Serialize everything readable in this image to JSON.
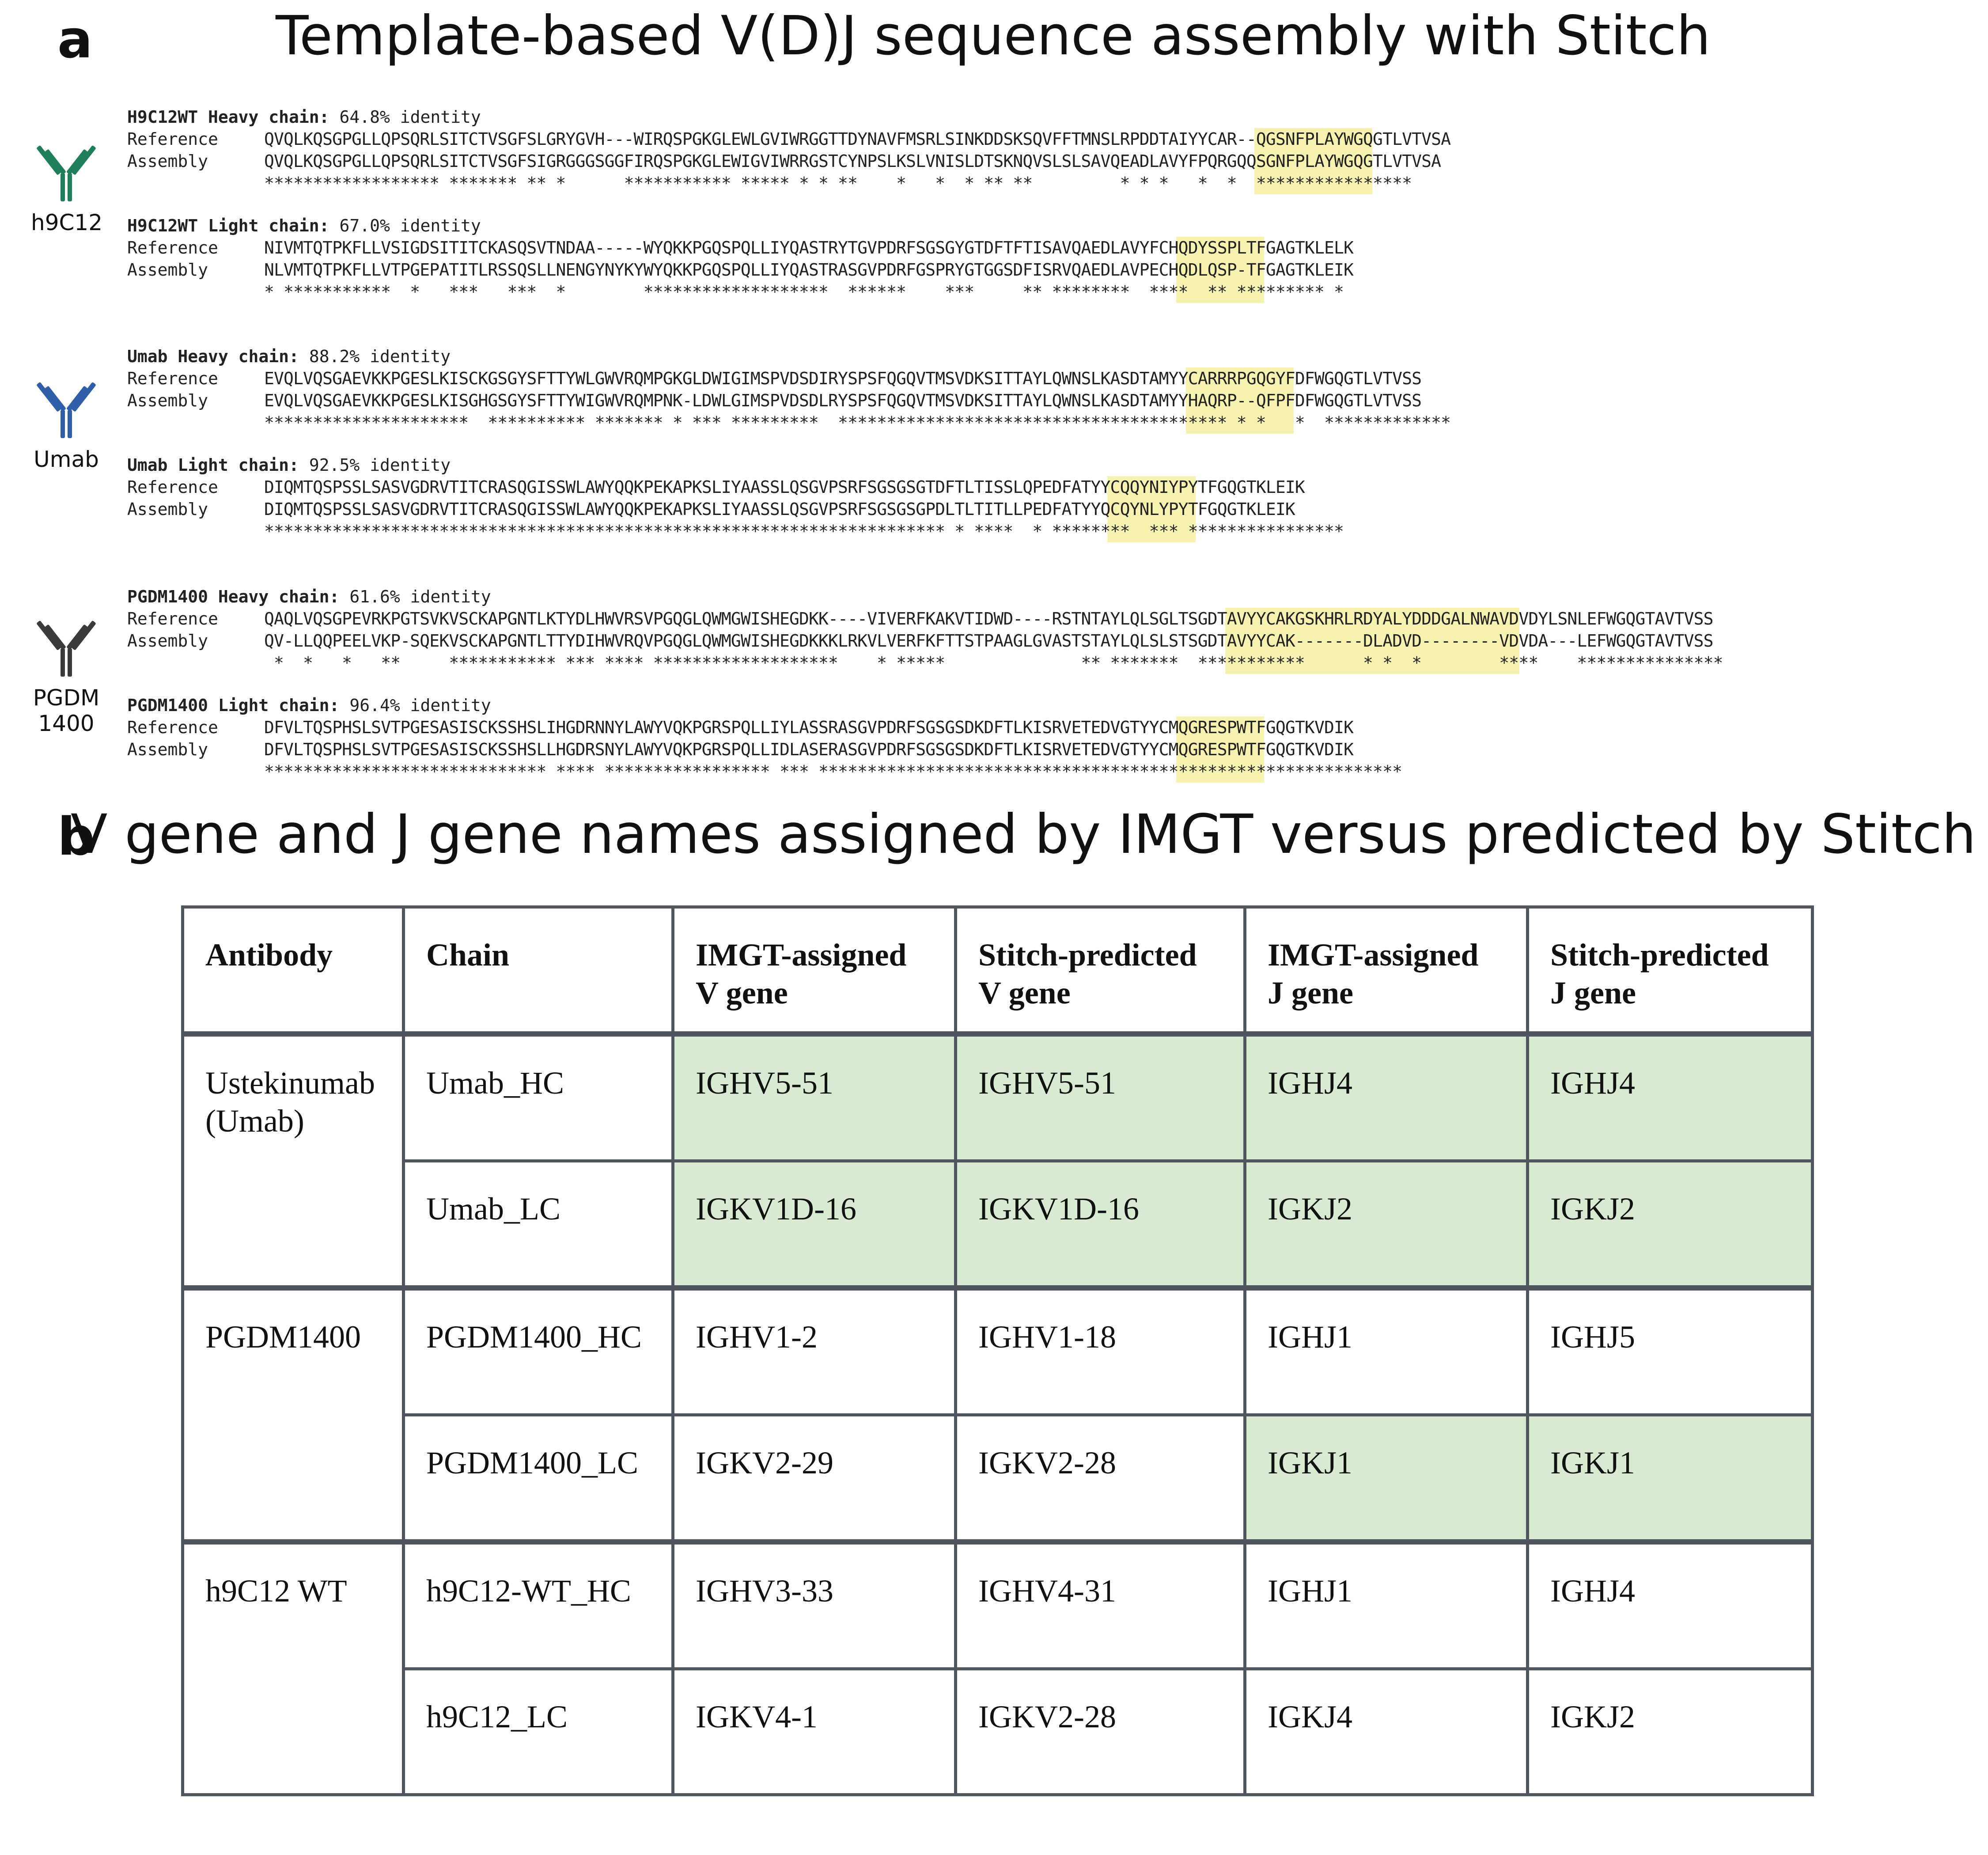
{
  "panel_a": {
    "letter": "a",
    "title": "Template-based V(D)J sequence assembly with Stitch",
    "groups": [
      {
        "icon_label": "h9C12",
        "icon_color": "#1e7f5a",
        "chains": [
          {
            "name": "H9C12WT Heavy chain:",
            "identity": " 64.8% identity",
            "reference_label": "Reference",
            "reference": "QVQLKQSGPGLLQPSQRLSITCTVSGFSLGRYGVH---WIRQSPGKGLEWLGVIWRGGTTDYNAVFMSRLSINKDDSKSQVFFTMNSLRPDDTAIYYCAR--QGSNFPLAYWGQGTLVTVSA",
            "assembly_label": "Assembly",
            "assembly": "QVQLKQSGPGLLQPSQRLSITCTVSGFSIGRGGGSGGFIRQSPGKGLEWIGVIWRRGSTCYNPSLKSLVNISLDTSKNQVSLSLSAVQEADLAVYFPQRGQQSGNFPLAYWGQGTLVTVSA",
            "conservation": "****************** ******* ** *      *********** ***** * * **    *   *  * ** **         * * *   *  *  ****************"
          },
          {
            "name": "H9C12WT Light chain:",
            "identity": " 67.0% identity",
            "reference_label": "Reference",
            "reference": "NIVMTQTPKFLLVSIGDSITITCKASQSVTNDAA-----WYQKKPGQSPQLLIYQASTRYTGVPDRFSGSGYGTDFTFTISAVQAEDLAVYFCHQDYSSPLTFGAGTKLELK",
            "assembly_label": "Assembly",
            "assembly": "NLVMTQTPKFLLVTPGEPATITLRSSQSLLNENGYNYKYWYQKKPGQSPQLLIYQASTRASGVPDRFGSPRYGTGGSDFISRVQAEDLAVPECHQDLQSP-TFGAGTKLEIK",
            "conservation": "* ***********  *   ***   ***  *        *******************  ******    ***     ** ********  ****  ** ********* *"
          },
          {
            "name": "Umab Heavy chain:",
            "identity": " 88.2% identity",
            "reference_label": "Reference",
            "reference": "EVQLVQSGAEVKKPGESLKISCKGSGYSFTTYWLGWVRQMPGKGLDWIGIMSPVDSDIRYSPSFQGQVTMSVDKSITTAYLQWNSLKASDTAMYYCARRRPGQGYFDFWGQGTLVTVSS",
            "assembly_label": "Assembly",
            "assembly": "EVQLVQSGAEVKKPGESLKISGHGSGYSFTTYWIGWVRQMPNK-LDWLGIMSPVDSDLRYSPSFQGQVTMSVDKSITTAYLQWNSLKASDTAMYYHAQRP--QFPFDFWGQGTLVTVSS",
            "conservation": "*********************  ********** ******* * *** *********  **************************************** * *   *  *************"
          },
          {
            "name": "Umab Light chain:",
            "identity": " 92.5% identity",
            "reference_label": "Reference",
            "reference": "DIQMTQSPSSLSASVGDRVTITCRASQGISSWLAWYQQKPEKAPKSLIYAASSLQSGVPSRFSGSGSGTDFTLTISSLQPEDFATYYCQQYNIYPYTFGQGTKLEIK",
            "assembly_label": "Assembly",
            "assembly": "DIQMTQSPSSLSASVGDRVTITCRASQGISSWLAWYQQKPEKAPKSLIYAASSLQSGVPSRFSGSGSGPDLTLTITLLPEDFATYYQCQYNLYPYTFGQGTKLEIK",
            "conservation": "********************************************************************** * ****  * ********  *** ****************"
          },
          {
            "name": "PGDM1400 Heavy chain:",
            "identity": " 61.6% identity",
            "reference_label": "Reference",
            "reference": "QAQLVQSGPEVRKPGTSVKVSCKAPGNTLKTYDLHWVRSVPGQGLQWMGWISHEGDKK----VIVERFKAKVTIDWD----RSTNTAYLQLSGLTSGDTAVYYCAKGSKHRLRDYALYDDDGALNWAVDVDYLSNLEFWGQGTAVTVSS",
            "assembly_label": "Assembly",
            "assembly": "QV-LLQQPEELVKP-SQEKVSCKAPGNTLTTYDIHWVRQVPGQGLQWMGWISHEGDKKKLRKVLVERFKFTTSTPAAGLGVASTSTAYLQLSLSTSGDTAVYYCAK-------DLADVD--------VDVDA---LEFWGQGTAVTVSS",
            "conservation": " *  *   *   **     *********** *** **** *******************    * *****              ** *******  ***********      * *  *        ****    ***************"
          },
          {
            "name": "PGDM1400 Light chain:",
            "identity": " 96.4% identity",
            "reference_label": "Reference",
            "reference": "DFVLTQSPHSLSVTPGESASISCKSSHSLIHGDRNNYLAWYVQKPGRSPQLLIYLASSRASGVPDRFSGSGSDKDFTLKISRVETEDVGTYYCMQGRESPWTFGQGTKVDIK",
            "assembly_label": "Assembly",
            "assembly": "DFVLTQSPHSLSVTPGESASISCKSSHSLLHGDRSNYLAWYVQKPGRSPQLLIDLASERASGVPDRFSGSGSDKDFTLKISRVETEDVGTYYCMQGRESPWTFGQGTKVDIK",
            "conservation": "***************************** **** ***************** *** ************************************************************"
          }
        ]
      },
      {
        "icon_label": "Umab",
        "icon_color": "#2f5fa8"
      },
      {
        "icon_label": "PGDM\n1400",
        "icon_color": "#3a3a3a"
      }
    ],
    "highlight_color": "#f7f2b0"
  },
  "panel_b": {
    "letter": "b",
    "title": "V gene and J gene names assigned by IMGT versus predicted by Stitch",
    "headers": [
      "Antibody",
      "Chain",
      "IMGT-assigned\nV gene",
      "Stitch-predicted\nV gene",
      "IMGT-assigned\nJ gene",
      "Stitch-predicted\nJ gene"
    ],
    "rows": [
      {
        "antibody": "Ustekinumab\n(Umab)",
        "chain": "Umab_HC",
        "imgt_v": "IGHV5-51",
        "stitch_v": "IGHV5-51",
        "imgt_j": "IGHJ4",
        "stitch_j": "IGHJ4"
      },
      {
        "antibody": "",
        "chain": "Umab_LC",
        "imgt_v": "IGKV1D-16",
        "stitch_v": "IGKV1D-16",
        "imgt_j": "IGKJ2",
        "stitch_j": "IGKJ2"
      },
      {
        "antibody": "PGDM1400",
        "chain": "PGDM1400_HC",
        "imgt_v": "IGHV1-2",
        "stitch_v": "IGHV1-18",
        "imgt_j": "IGHJ1",
        "stitch_j": "IGHJ5"
      },
      {
        "antibody": "",
        "chain": "PGDM1400_LC",
        "imgt_v": "IGKV2-29",
        "stitch_v": "IGKV2-28",
        "imgt_j": "IGKJ1",
        "stitch_j": "IGKJ1"
      },
      {
        "antibody": "h9C12 WT",
        "chain": "h9C12-WT_HC",
        "imgt_v": "IGHV3-33",
        "stitch_v": "IGHV4-31",
        "imgt_j": "IGHJ1",
        "stitch_j": "IGHJ4"
      },
      {
        "antibody": "",
        "chain": "h9C12_LC",
        "imgt_v": "IGKV4-1",
        "stitch_v": "IGKV2-28",
        "imgt_j": "IGKJ4",
        "stitch_j": "IGKJ2"
      }
    ],
    "match_color": "#d9ead3"
  }
}
